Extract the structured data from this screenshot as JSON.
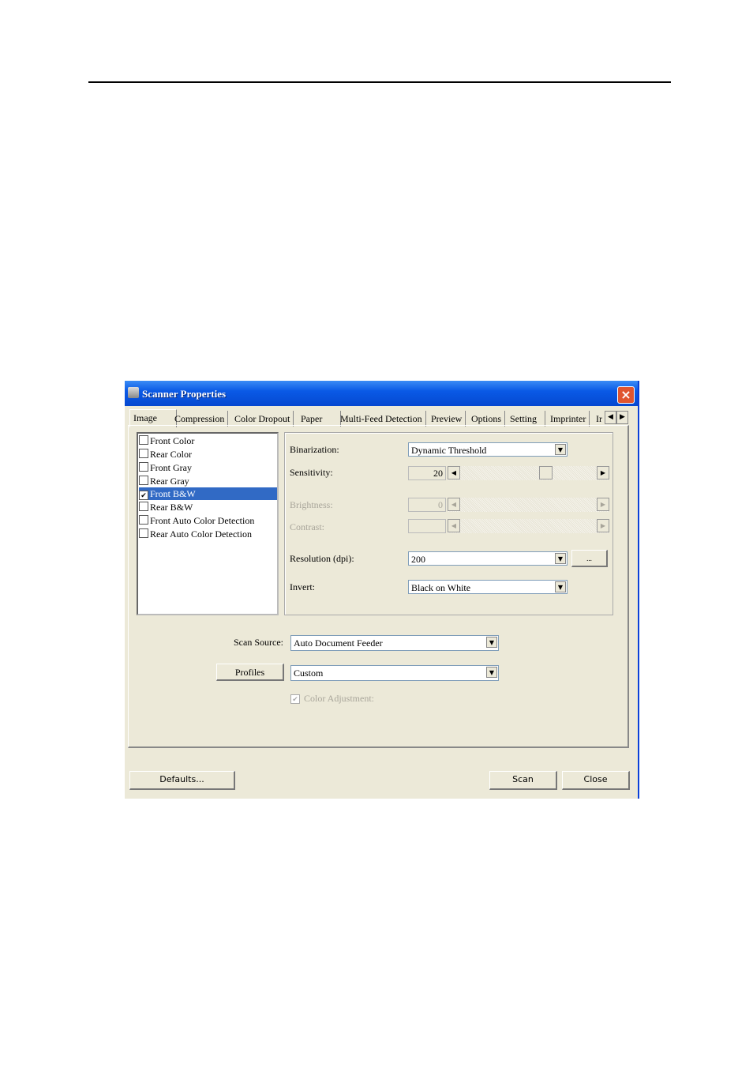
{
  "window": {
    "title": "Scanner Properties"
  },
  "tabs": [
    "Image",
    "Compression",
    "Color Dropout",
    "Paper",
    "Multi-Feed Detection",
    "Preview",
    "Options",
    "Setting",
    "Imprinter",
    "Ir"
  ],
  "image_list": [
    {
      "label": "Front Color",
      "checked": false
    },
    {
      "label": "Rear Color",
      "checked": false
    },
    {
      "label": "Front Gray",
      "checked": false
    },
    {
      "label": "Rear Gray",
      "checked": false
    },
    {
      "label": "Front B&W",
      "checked": true,
      "selected": true
    },
    {
      "label": "Rear B&W",
      "checked": false
    },
    {
      "label": "Front Auto Color Detection",
      "checked": false
    },
    {
      "label": "Rear Auto Color Detection",
      "checked": false
    }
  ],
  "settings": {
    "binarization_label": "Binarization:",
    "binarization_value": "Dynamic Threshold",
    "sensitivity_label": "Sensitivity:",
    "sensitivity_value": "20",
    "brightness_label": "Brightness:",
    "brightness_value": "0",
    "contrast_label": "Contrast:",
    "resolution_label": "Resolution (dpi):",
    "resolution_value": "200",
    "resolution_more": "...",
    "invert_label": "Invert:",
    "invert_value": "Black on White"
  },
  "scan_source_label": "Scan Source:",
  "scan_source_value": "Auto Document Feeder",
  "profiles_button": "Profiles",
  "profiles_value": "Custom",
  "color_adjustment_label": "Color Adjustment:",
  "buttons": {
    "defaults": "Defaults...",
    "scan": "Scan",
    "close": "Close"
  },
  "colors": {
    "titlebar": "#0a5ae6",
    "selection": "#316ac5",
    "dialog_bg": "#ece9d8"
  }
}
